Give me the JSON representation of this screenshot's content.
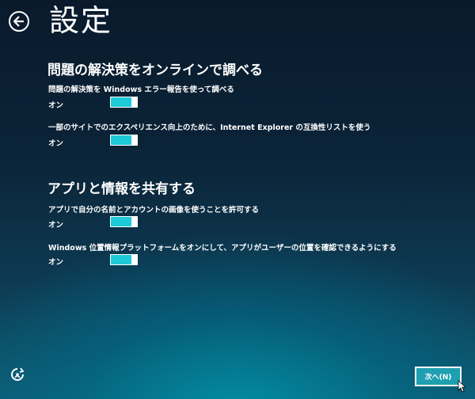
{
  "page": {
    "title": "設定"
  },
  "sections": [
    {
      "heading": "問題の解決策をオンラインで調べる",
      "settings": [
        {
          "label": "問題の解決策を Windows エラー報告を使って調べる",
          "state": "オン",
          "on": true
        },
        {
          "label": "一部のサイトでのエクスペリエンス向上のために、Internet Explorer の互換性リストを使う",
          "state": "オン",
          "on": true
        }
      ]
    },
    {
      "heading": "アプリと情報を共有する",
      "settings": [
        {
          "label": "アプリで自分の名前とアカウントの画像を使うことを許可する",
          "state": "オン",
          "on": true
        },
        {
          "label": "Windows 位置情報プラットフォームをオンにして、アプリがユーザーの位置を確認できるようにする",
          "state": "オン",
          "on": true
        }
      ]
    }
  ],
  "footer": {
    "next_label": "次へ(N)"
  },
  "colors": {
    "toggle_fill": "#1ec9d8",
    "button_fill": "#1f9fb0"
  },
  "icons": {
    "back": "back-arrow-icon",
    "ease_of_access": "ease-of-access-icon",
    "cursor": "mouse-pointer-icon"
  }
}
